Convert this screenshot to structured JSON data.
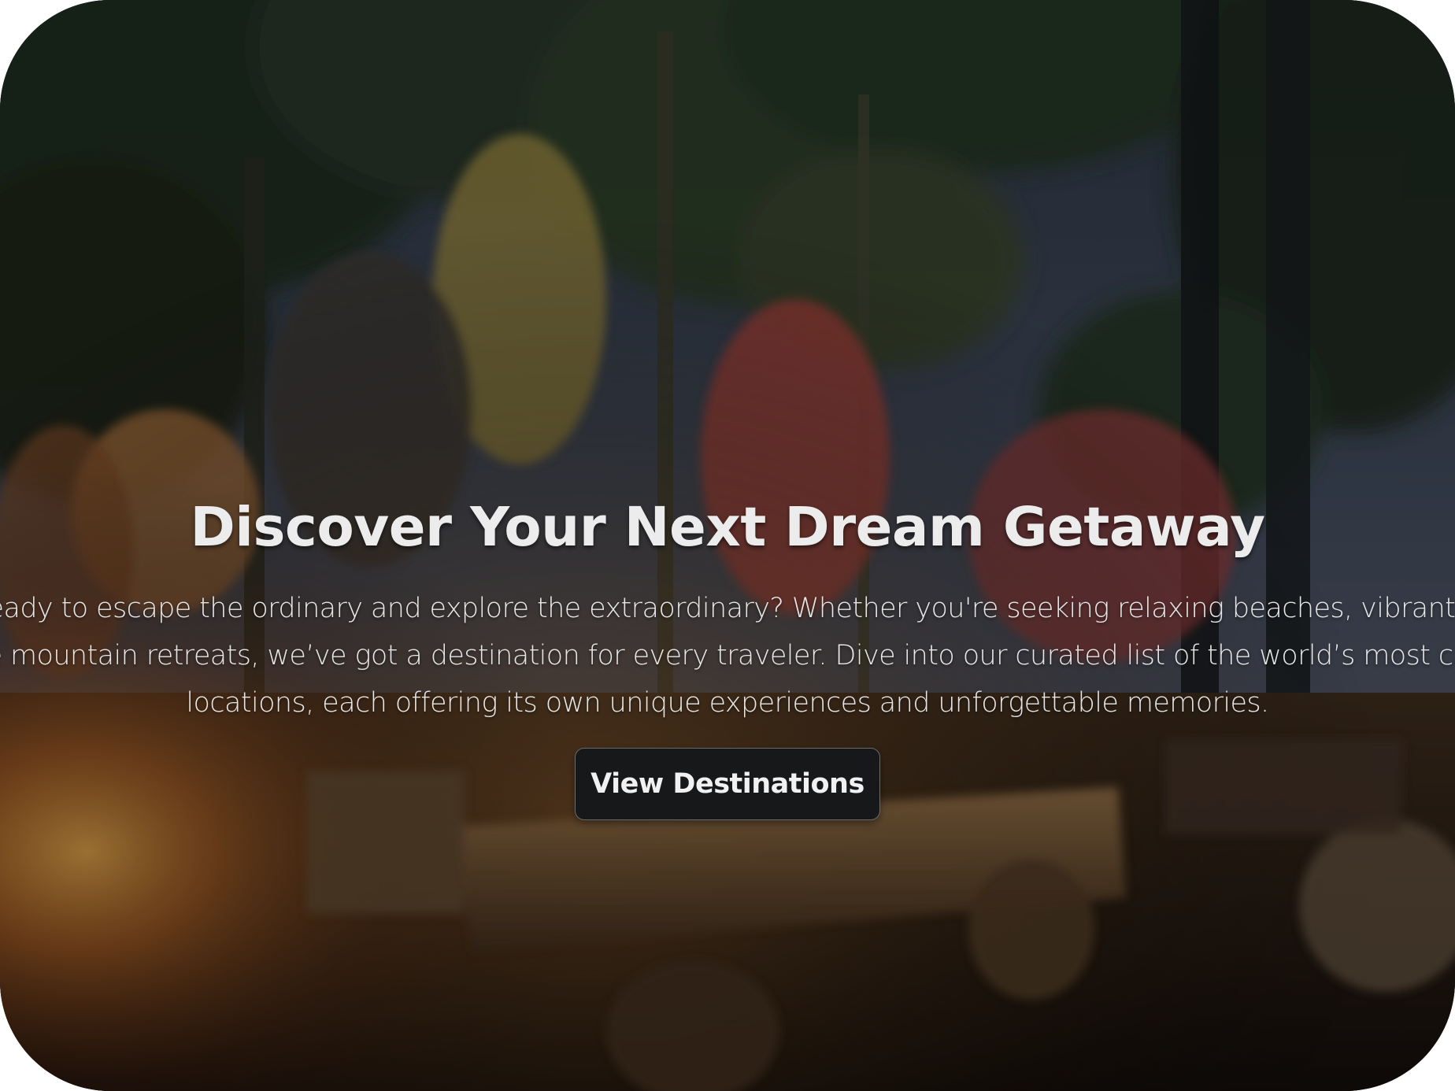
{
  "hero": {
    "title": "Discover Your Next Dream Getaway",
    "description_lines": [
      "Ready to escape the ordinary and explore the extraordinary? Whether you're seeking relaxing beaches, vibrant ci",
      "he mountain retreats, we’ve got a destination for every traveler. Dive into our curated list of the world’s most cap",
      "locations, each offering its own unique experiences and unforgettable memories."
    ],
    "cta_label": "View Destinations",
    "background_image": "campfire-night-forest-photo"
  },
  "colors": {
    "title_text": "#ececec",
    "body_text": "#e6e6e6",
    "button_bg": "#17181a",
    "button_text": "#f1f1f1"
  }
}
